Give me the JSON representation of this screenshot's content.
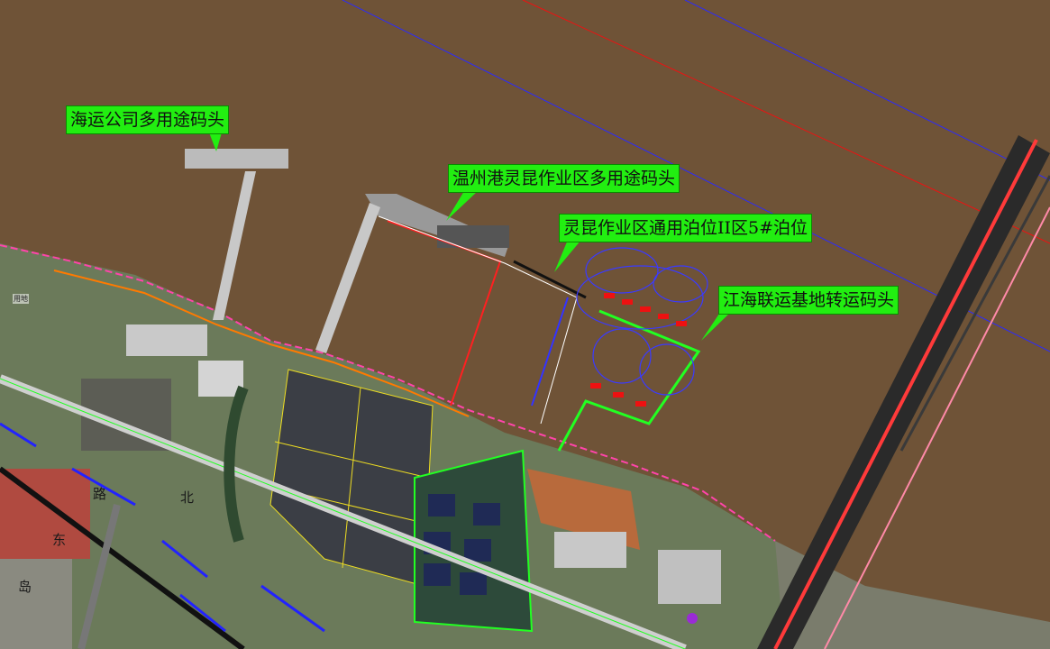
{
  "labels": {
    "haiyun_wharf": "海运公司多用途码头",
    "wenzhou_wharf": "温州港灵昆作业区多用途码头",
    "lingkun_berth": "灵昆作业区通用泊位II区5#泊位",
    "jianghai_wharf": "江海联运基地转运码头"
  },
  "road_labels": {
    "lu": "路",
    "bei": "北",
    "dong": "东",
    "dao": "岛"
  },
  "land_use_label": "用地"
}
